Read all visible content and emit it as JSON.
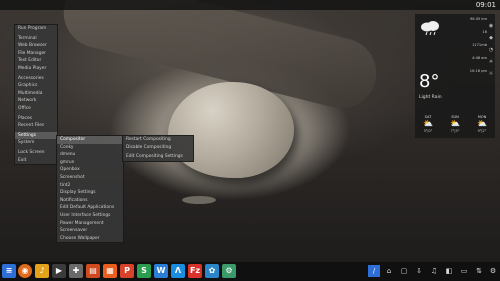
{
  "clock": "09:01",
  "main_menu": {
    "items": [
      "Run Program",
      "Terminal",
      "Web Browser",
      "File Manager",
      "Text Editor",
      "Media Player",
      "Accessories",
      "Graphics",
      "Multimedia",
      "Network",
      "Office",
      "Places",
      "Recent Files",
      "Settings",
      "System",
      "Lock Screen",
      "Exit"
    ],
    "selected": "Settings"
  },
  "settings_menu": {
    "items": [
      "Compositor",
      "Conky",
      "dmenu",
      "gmrun",
      "Openbox",
      "Screenshot",
      "tint2",
      "Display Settings",
      "Notifications",
      "Edit Default Applications",
      "User Interface Settings",
      "Power Management",
      "Screensaver",
      "Choose Wallpaper"
    ],
    "selected": "Compositor"
  },
  "compositor_menu": {
    "items": [
      "Restart Compositing",
      "Disable Compositing",
      "Edit Compositing Settings"
    ]
  },
  "weather": {
    "current_icon": "rain-cloud-icon",
    "temperature": "8°",
    "condition": "Light Rain",
    "stats": [
      "96.05 km",
      "16",
      "1171mb",
      "4:46 am",
      "10:16 pm"
    ],
    "forecast": [
      {
        "day": "SAT",
        "temps": "3°|0°",
        "icon": "sun-cloud-icon"
      },
      {
        "day": "SUN",
        "temps": "7°|3°",
        "icon": "sun-cloud-icon"
      },
      {
        "day": "MON",
        "temps": "9°|2°",
        "icon": "sun-cloud-icon"
      }
    ]
  },
  "colors": {
    "accent_blue": "#2d6fd6",
    "dock_bg": "#121212"
  }
}
